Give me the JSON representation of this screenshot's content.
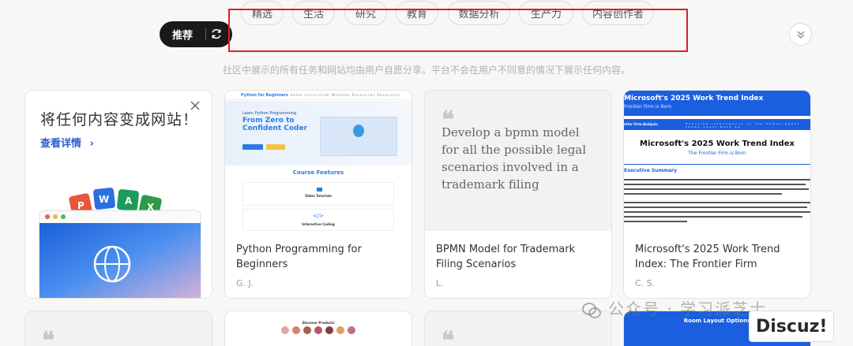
{
  "filter": {
    "primary_label": "推荐",
    "tags": [
      "精选",
      "生活",
      "研究",
      "教育",
      "数据分析",
      "生产力",
      "内容创作者"
    ]
  },
  "notice": "社区中展示的所有任务和网站均由用户自愿分享。平台不会在用户不同意的情况下展示任何内容。",
  "promo": {
    "title": "将任何内容变成网站！",
    "link": "查看详情",
    "badge_letters": [
      "P",
      "W",
      "A",
      "X"
    ]
  },
  "cards": [
    {
      "title": "Python Programming for Beginners",
      "author": "G. J.",
      "preview": {
        "brand": "Python for Beginners",
        "nav": "Home Curriculum Modules Resources Resources",
        "hero_small": "Learn Python Programming",
        "hero_big": "From Zero to Confident Coder",
        "section": "Course Features",
        "feature1": "Video Tutorials",
        "feature2": "Interactive Coding"
      }
    },
    {
      "title": "BPMN Model for Trademark Filing Scenarios",
      "author": "L.",
      "quote": "Develop a bpmn model for all the possible legal scenarios involved in a trademark filing"
    },
    {
      "title": "Microsoft's 2025 Work Trend Index: The Frontier Firm",
      "author": "C. S.",
      "preview": {
        "top_title": "Microsoft's 2025 Work Trend Index",
        "top_sub": "Frontier Firm is Born",
        "nav_name": "ntier Firm Analysis",
        "nav_links": "Overview  Intelligence on Tap  Human-Agent Teams  Agent Boss  Ge",
        "h1": "Microsoft's 2025 Work Trend Index",
        "h2": "The Frontier Firm is Born",
        "section": "Executive Summary"
      }
    }
  ],
  "row2": {
    "shop_heading": "Discover Products",
    "room_heading": "Room Layout Options"
  },
  "watermark": "公众号 · 学习派芝士",
  "discuz": "Discuz!"
}
